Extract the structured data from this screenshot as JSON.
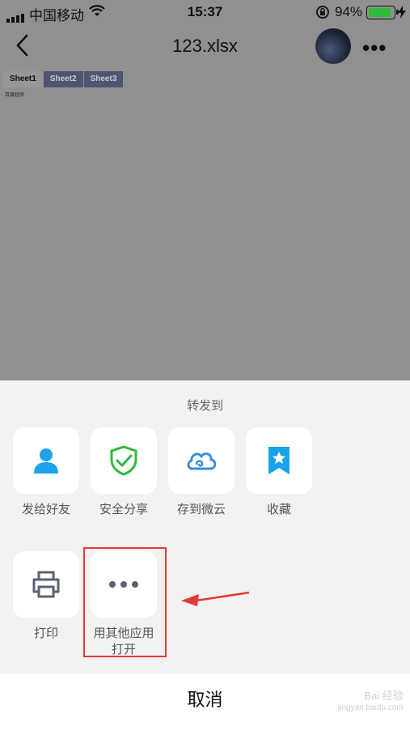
{
  "status_bar": {
    "carrier": "中国移动",
    "time": "15:37",
    "battery_percent": "94%",
    "battery_level": 0.94
  },
  "nav": {
    "title": "123.xlsx"
  },
  "sheets": {
    "tabs": [
      "Sheet1",
      "Sheet2",
      "Sheet3"
    ],
    "active": "Sheet1",
    "cell_text": "百度经验"
  },
  "share_sheet": {
    "title": "转发到",
    "row1": [
      {
        "label": "发给好友",
        "icon": "person-icon",
        "color": "#1aa3e8"
      },
      {
        "label": "安全分享",
        "icon": "shield-check-icon",
        "color": "#2dba3c"
      },
      {
        "label": "存到微云",
        "icon": "cloud-icon",
        "color": "#3a8de0"
      },
      {
        "label": "收藏",
        "icon": "bookmark-star-icon",
        "color": "#1aa3e8"
      }
    ],
    "row2": [
      {
        "label": "打印",
        "icon": "printer-icon",
        "color": "#5d6173"
      },
      {
        "label": "用其他应用\n打开",
        "icon": "more-dots-icon",
        "color": "#5d6173"
      }
    ],
    "cancel": "取消"
  },
  "watermark": {
    "line1": "Bai 经验",
    "line2": "jingyan.baidu.com"
  },
  "colors": {
    "highlight": "#e53935",
    "overlay": "#909090"
  }
}
